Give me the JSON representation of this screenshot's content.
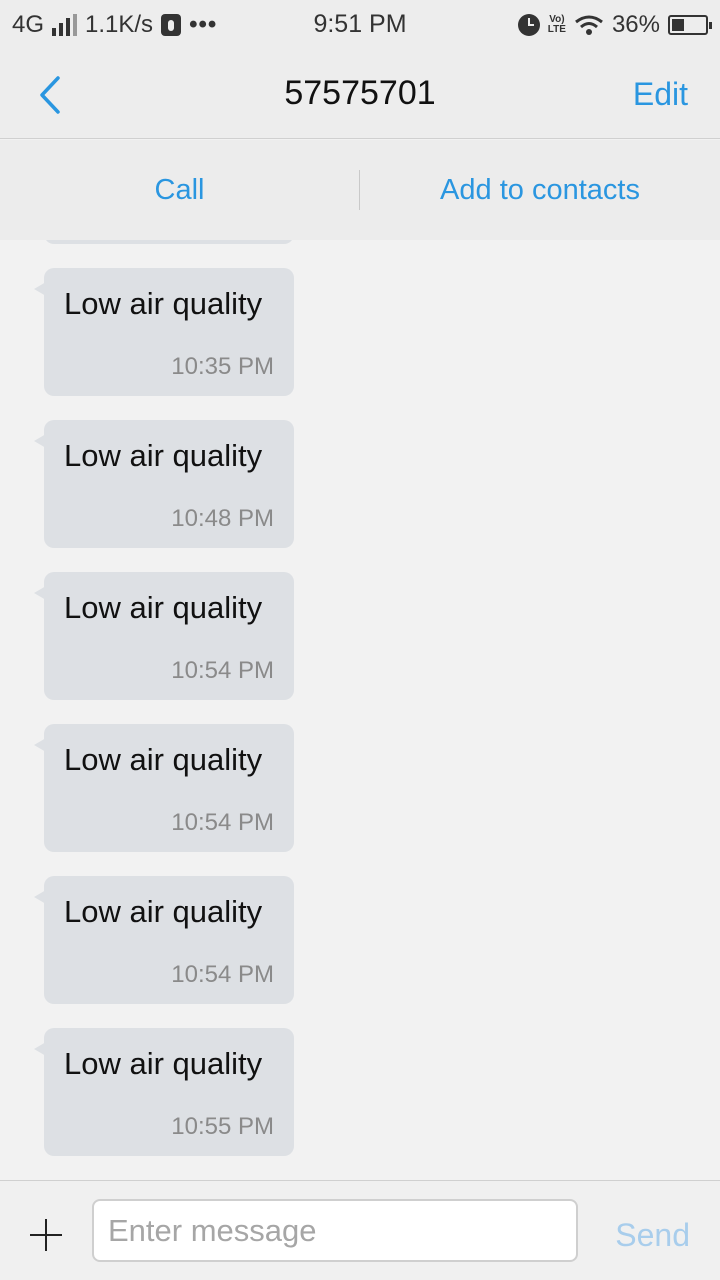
{
  "status_bar": {
    "network": "4G",
    "speed": "1.1K/s",
    "more": "•••",
    "time": "9:51 PM",
    "volte": "Vo) LTE",
    "battery": "36%",
    "battery_level": 0.36
  },
  "header": {
    "title": "57575701",
    "edit_label": "Edit"
  },
  "actions": {
    "call_label": "Call",
    "add_contact_label": "Add to contacts"
  },
  "messages": [
    {
      "text": "Low air quality",
      "time": "10:35 PM"
    },
    {
      "text": "Low air quality",
      "time": "10:48 PM"
    },
    {
      "text": "Low air quality",
      "time": "10:54 PM"
    },
    {
      "text": "Low air quality",
      "time": "10:54 PM"
    },
    {
      "text": "Low air quality",
      "time": "10:54 PM"
    },
    {
      "text": "Low air quality",
      "time": "10:55 PM"
    }
  ],
  "composer": {
    "placeholder": "Enter message",
    "send_label": "Send"
  },
  "colors": {
    "accent": "#2a96e0",
    "bubble": "#dde0e4",
    "send_disabled": "#a8cdec"
  }
}
